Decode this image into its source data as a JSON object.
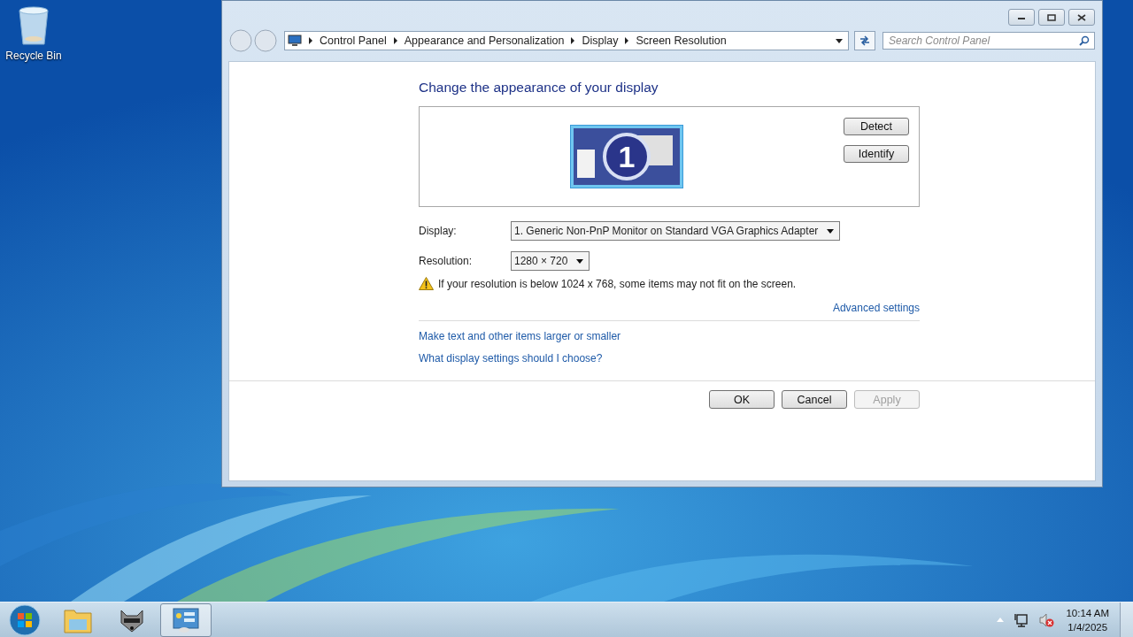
{
  "desktop": {
    "icons": [
      {
        "label": "Recycle Bin"
      }
    ]
  },
  "window": {
    "breadcrumb": [
      "Control Panel",
      "Appearance and Personalization",
      "Display",
      "Screen Resolution"
    ],
    "search": {
      "placeholder": "Search Control Panel"
    },
    "heading": "Change the appearance of your display",
    "monitor": {
      "number": "1"
    },
    "side_buttons": [
      "Detect",
      "Identify"
    ],
    "fields": [
      {
        "label": "Display:",
        "value": "1. Generic Non-PnP Monitor on Standard VGA Graphics Adapter"
      },
      {
        "label": "Resolution:",
        "value": "1280 × 720"
      }
    ],
    "warning": "If your resolution is below 1024 x 768, some items may not fit on the screen.",
    "advanced_link": "Advanced settings",
    "links": [
      "Make text and other items larger or smaller",
      "What display settings should I choose?"
    ],
    "buttons": [
      {
        "label": "OK",
        "disabled": false
      },
      {
        "label": "Cancel",
        "disabled": false
      },
      {
        "label": "Apply",
        "disabled": true
      }
    ]
  },
  "taskbar": {
    "apps": [
      {
        "kind": "start",
        "selected": false
      },
      {
        "kind": "folder",
        "selected": false
      },
      {
        "kind": "raccoon",
        "selected": false
      },
      {
        "kind": "control-panel",
        "selected": true
      }
    ],
    "clock": {
      "time": "10:14 AM",
      "date": "1/4/2025"
    }
  }
}
